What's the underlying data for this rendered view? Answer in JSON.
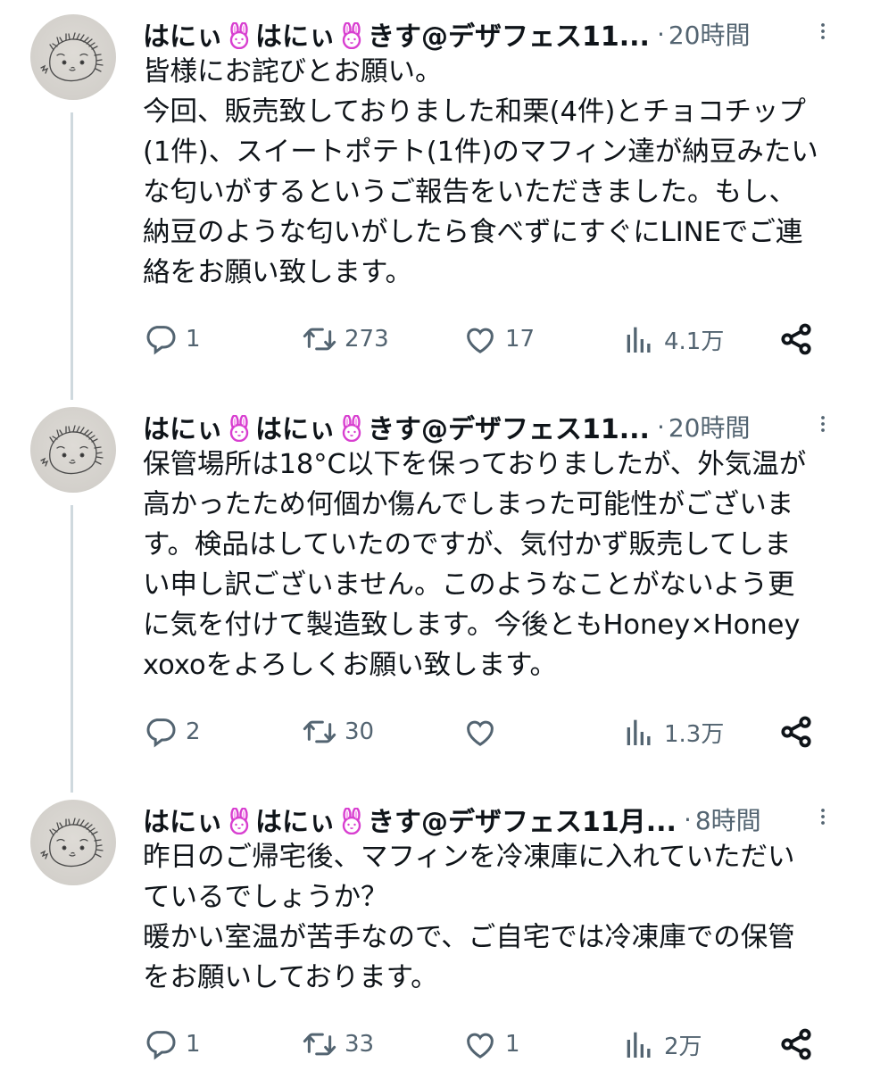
{
  "tweets": [
    {
      "display_name": "はにぃ🐰はにぃ🐰きす@デザフェス11...",
      "separator": "·",
      "time": "20時間",
      "body_lines": [
        "皆様にお詫びとお願い。",
        "今回、販売致しておりました和栗(4件)とチョコチップ",
        "(1件)、スイートポテト(1件)のマフィン達が納豆みたい",
        "な匂いがするというご報告をいただきました。もし、",
        "納豆のような匂いがしたら食べずにすぐにLINEでご連",
        "絡をお願い致します。"
      ],
      "stats": {
        "replies": "1",
        "retweets": "273",
        "likes": "17",
        "views": "4.1万"
      }
    },
    {
      "display_name": "はにぃ🐰はにぃ🐰きす@デザフェス11...",
      "separator": "·",
      "time": "20時間",
      "body_lines": [
        "保管場所は18°C以下を保っておりましたが、外気温が",
        "高かったため何個か傷んでしまった可能性がございま",
        "す。検品はしていたのですが、気付かず販売してしま",
        "い申し訳ございません。このようなことがないよう更",
        "に気を付けて製造致します。今後ともHoney×Honey",
        "xoxoをよろしくお願い致します。"
      ],
      "stats": {
        "replies": "2",
        "retweets": "30",
        "likes": "",
        "views": "1.3万"
      }
    },
    {
      "display_name": "はにぃ🐰はにぃ🐰きす@デザフェス11月...",
      "separator": "·",
      "time": "8時間",
      "body_lines": [
        "昨日のご帰宅後、マフィンを冷凍庫に入れていただい",
        "ているでしょうか？",
        "暖かい室温が苦手なので、ご自宅では冷凍庫での保管",
        "をお願いしております。"
      ],
      "stats": {
        "replies": "1",
        "retweets": "33",
        "likes": "1",
        "views": "2万"
      }
    }
  ],
  "icons": {
    "reply": "reply-icon",
    "retweet": "retweet-icon",
    "like": "heart-icon",
    "views": "views-chart-icon",
    "share": "share-icon",
    "more": "more-dots-icon"
  },
  "colors": {
    "text": "#0f1419",
    "secondary": "#536471",
    "thread_line": "#cfd9de",
    "bunny": "#d83fd0"
  }
}
